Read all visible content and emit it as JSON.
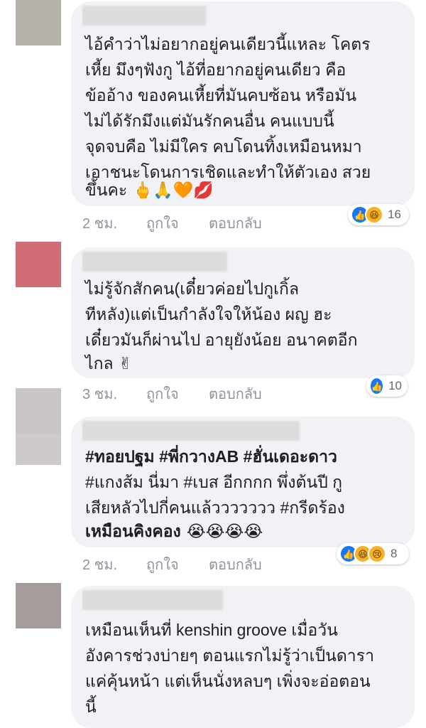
{
  "comments": [
    {
      "avatar_color": "#a8a39c",
      "lines": [
        "ไอ้คำว่าไม่อยากอยู่คนเดียวนี้แหละ โคตร",
        "เหี้ย มึงๆฟังกู ไอ้ที่อยากอยู่คนเดียว คือ",
        "ข้ออ้าง ของคนเหี้ยที่มันคบซ้อน หรือมัน",
        "ไม่ได้รักมึงแต่มันรักคนอื่น คนแบบนี้",
        "จุดจบคือ ไม่มีใคร คบโดนทิ้งเหมือนหมา",
        "เอาชนะโดนการเชิดและทำให้ตัวเอง สวย",
        "ขึ้นคะ 🖕🙏🧡💋"
      ],
      "time": "2 ชม.",
      "like": "ถูกใจ",
      "reply": "ตอบกลับ",
      "reaction_icons": [
        "like-icon",
        "haha-icon"
      ],
      "reaction_count": "16"
    },
    {
      "avatar_color": "#d26d78",
      "lines": [
        "ไม่รู้จักสักคน(เดี๋ยวค่อยไปกูเกิ้ล",
        "ทีหลัง)แต่เป็นกำลังใจให้น้อง ผญ ฮะ",
        "เดี๋ยวมันก็ผ่านไป อายุยังน้อย อนาคตอีก",
        "ไกล ✌"
      ],
      "time": "3 ชม.",
      "like": "ถูกใจ",
      "reply": "ตอบกลับ",
      "reaction_icons": [
        "like-icon"
      ],
      "reaction_count": "10"
    },
    {
      "avatar_color": "#c9c5c4",
      "lines": [
        "#ทอยปฐม #พี่กวางAB #ฮั่นเดอะดาว",
        "#แกงส้ม นี่มา #เบส อีกกกก พึ่งต้นปี กู",
        "เสียหลัวไปกี่คนแล้ววววววว #กรีดร้อง",
        "เหมือนคิงคอง 😭😭😭😭"
      ],
      "time": "2 ชม.",
      "like": "ถูกใจ",
      "reply": "ตอบกลับ",
      "reaction_icons": [
        "like-icon",
        "haha-icon",
        "sad-icon"
      ],
      "reaction_count": "8"
    },
    {
      "avatar_color": "#a59d9b",
      "lines": [
        "เหมือนเห็นที่ kenshin groove เมื่อวัน",
        "อังคารช่วงบ่ายๆ ตอนแรกไม่รู้ว่าเป็นดารา",
        "แค่คุ้นหน้า แต่เห็นนั่งหลบๆ เพิ่งจะอ่อตอน",
        "นี้"
      ]
    }
  ]
}
